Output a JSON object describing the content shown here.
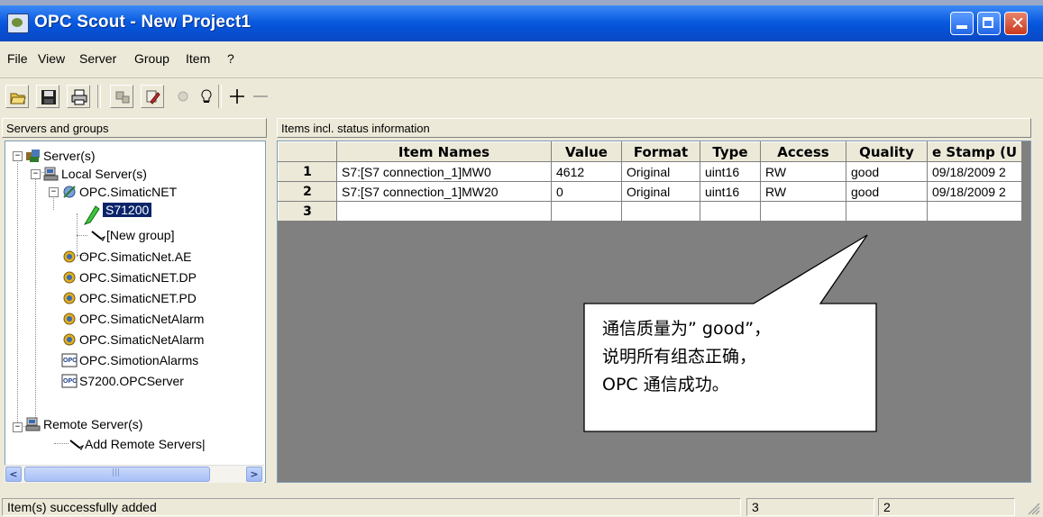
{
  "window": {
    "title": "OPC Scout - New Project1"
  },
  "menu": [
    "File",
    "View",
    "Server",
    "Group",
    "Item",
    "?"
  ],
  "panes": {
    "left_header": "Servers and groups",
    "right_header": "Items incl. status information"
  },
  "tree": {
    "root": "Server(s)",
    "local": "Local Server(s)",
    "simatic_net": "OPC.SimaticNET",
    "group_selected": "S71200",
    "new_group": "[New group]",
    "servers": [
      "OPC.SimaticNet.AE",
      "OPC.SimaticNET.DP",
      "OPC.SimaticNET.PD",
      "OPC.SimaticNetAlarm",
      "OPC.SimaticNetAlarm",
      "OPC.SimotionAlarms",
      "S7200.OPCServer"
    ],
    "remote": "Remote Server(s)",
    "add_remote": "Add Remote Servers|"
  },
  "table": {
    "headers": [
      "Item Names",
      "Value",
      "Format",
      "Type",
      "Access",
      "Quality",
      "e Stamp (U"
    ],
    "rows": [
      {
        "num": "1",
        "name": "S7:[S7 connection_1]MW0",
        "value": "4612",
        "format": "Original",
        "type": "uint16",
        "access": "RW",
        "quality": "good",
        "stamp": "09/18/2009 2"
      },
      {
        "num": "2",
        "name": "S7:[S7 connection_1]MW20",
        "value": "0",
        "format": "Original",
        "type": "uint16",
        "access": "RW",
        "quality": "good",
        "stamp": "09/18/2009 2"
      },
      {
        "num": "3",
        "name": "",
        "value": "",
        "format": "",
        "type": "",
        "access": "",
        "quality": "",
        "stamp": ""
      }
    ]
  },
  "callout": {
    "line1": "通信质量为” good”，",
    "line2": "说明所有组态正确，",
    "line3": "OPC 通信成功。"
  },
  "status": {
    "message": "Item(s) successfully added",
    "count1": "3",
    "count2": "2"
  },
  "colors": {
    "titlebar": "#0553d8",
    "selection": "#0a246a",
    "window_bg": "#ece9d8"
  }
}
